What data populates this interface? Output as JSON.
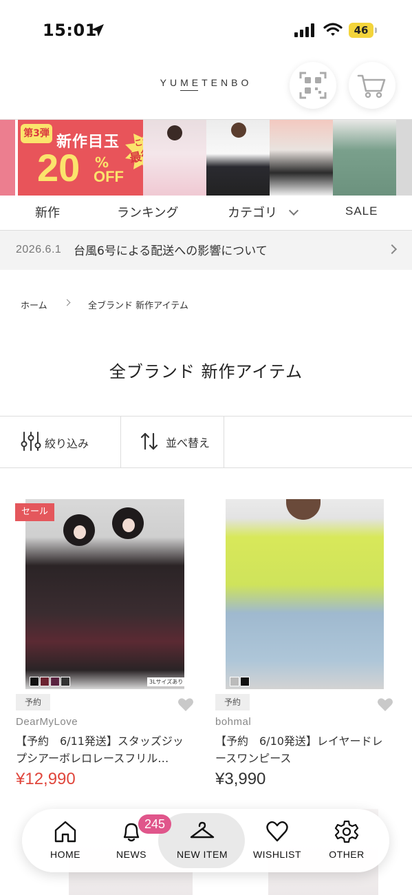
{
  "status_bar": {
    "time": "15:01",
    "battery": "46"
  },
  "header": {
    "logo": "YUMETENBO"
  },
  "banner": {
    "badge": "第3弾",
    "headline": "新作目玉",
    "discount": "20",
    "percent": "%",
    "off": "OFF",
    "burst_line1": "これが",
    "burst_line2": "最後!"
  },
  "nav": {
    "items": [
      "新作",
      "ランキング",
      "カテゴリ",
      "SALE"
    ]
  },
  "notice": {
    "date": "2026.6.1",
    "text": "台風6号による配送への影響について"
  },
  "breadcrumb": {
    "home": "ホーム",
    "current": "全ブランド 新作アイテム"
  },
  "page_title": "全ブランド 新作アイテム",
  "filter": {
    "filter_label": "絞り込み",
    "sort_label": "並べ替え"
  },
  "products": [
    {
      "sale_badge": "セール",
      "size_tag": "3Lサイズあり",
      "tag": "予約",
      "brand": "DearMyLove",
      "title": "【予約　6/11発送】スタッズジップシアーボレロレースフリル…",
      "price": "¥12,990",
      "swatch_colors": [
        "#111111",
        "#6b2330",
        "#5a2340",
        "#333333"
      ]
    },
    {
      "tag": "予約",
      "brand": "bohmal",
      "title": "【予約　6/10発送】レイヤードレースワンピース",
      "price": "¥3,990",
      "swatch_colors": [
        "#bbbbbb",
        "#111111"
      ]
    }
  ],
  "tabbar": {
    "items": [
      "HOME",
      "NEWS",
      "NEW ITEM",
      "WISHLIST",
      "OTHER"
    ],
    "news_count": "245",
    "active": "NEW ITEM"
  },
  "colors": {
    "sale_red": "#e4575c",
    "badge_pink": "#e0568b"
  }
}
